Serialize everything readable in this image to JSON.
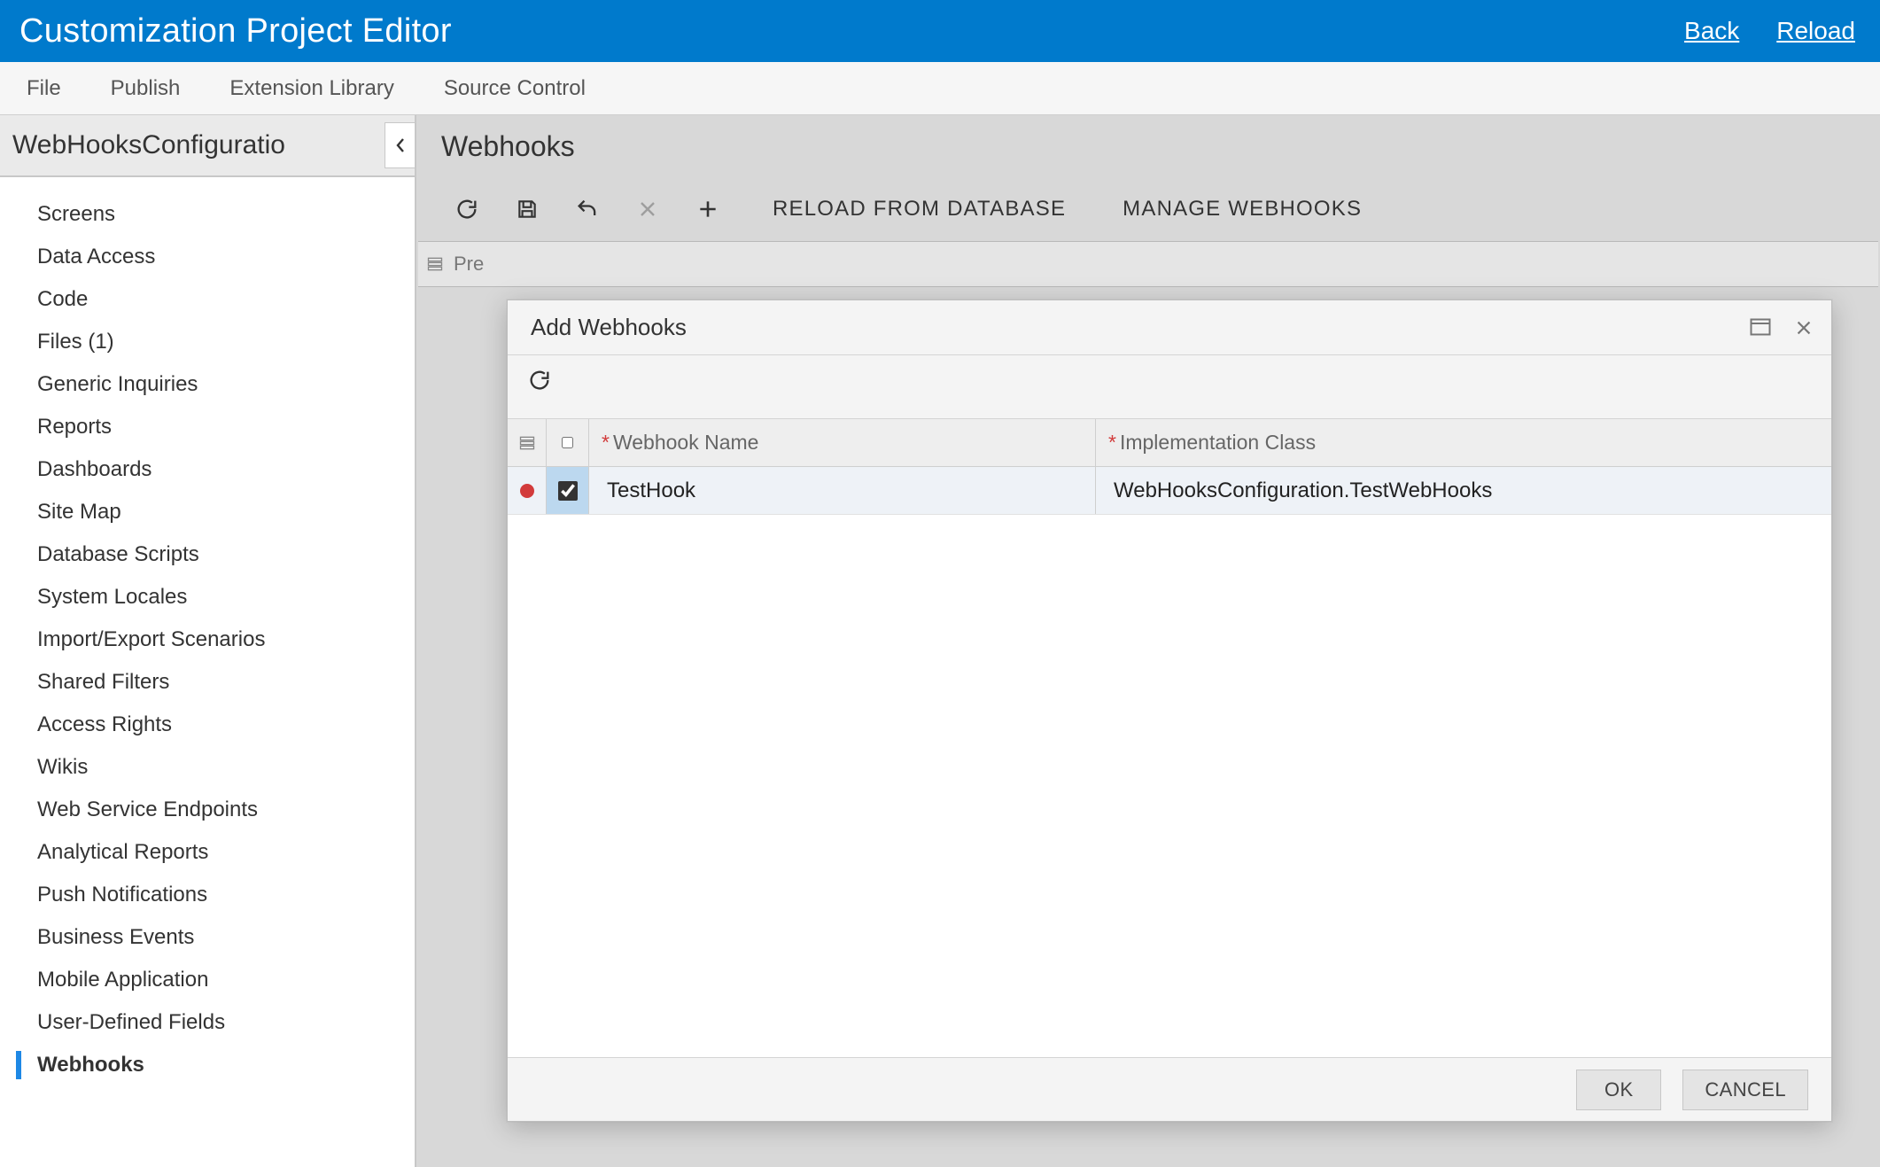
{
  "header": {
    "title": "Customization Project Editor",
    "links": {
      "back": "Back",
      "reload": "Reload"
    }
  },
  "menubar": {
    "file": "File",
    "publish": "Publish",
    "extension_library": "Extension Library",
    "source_control": "Source Control"
  },
  "sidebar": {
    "project_name": "WebHooksConfiguratio",
    "items": [
      {
        "label": "Screens"
      },
      {
        "label": "Data Access"
      },
      {
        "label": "Code"
      },
      {
        "label": "Files (1)"
      },
      {
        "label": "Generic Inquiries"
      },
      {
        "label": "Reports"
      },
      {
        "label": "Dashboards"
      },
      {
        "label": "Site Map"
      },
      {
        "label": "Database Scripts"
      },
      {
        "label": "System Locales"
      },
      {
        "label": "Import/Export Scenarios"
      },
      {
        "label": "Shared Filters"
      },
      {
        "label": "Access Rights"
      },
      {
        "label": "Wikis"
      },
      {
        "label": "Web Service Endpoints"
      },
      {
        "label": "Analytical Reports"
      },
      {
        "label": "Push Notifications"
      },
      {
        "label": "Business Events"
      },
      {
        "label": "Mobile Application"
      },
      {
        "label": "User-Defined Fields"
      },
      {
        "label": "Webhooks",
        "selected": true
      }
    ]
  },
  "content": {
    "title": "Webhooks",
    "toolbar": {
      "reload_db": "RELOAD FROM DATABASE",
      "manage": "MANAGE WEBHOOKS"
    },
    "bg_grid_label": "Pre"
  },
  "modal": {
    "title": "Add Webhooks",
    "columns": {
      "name": "Webhook Name",
      "impl": "Implementation Class"
    },
    "rows": [
      {
        "checked": true,
        "name": "TestHook",
        "impl": "WebHooksConfiguration.TestWebHooks"
      }
    ],
    "buttons": {
      "ok": "OK",
      "cancel": "CANCEL"
    }
  }
}
